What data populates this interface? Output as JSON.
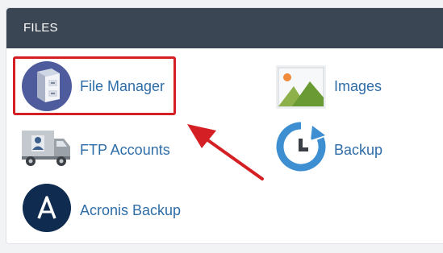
{
  "section": {
    "title": "FILES"
  },
  "items": [
    {
      "label": "File Manager",
      "icon": "file-cabinet-icon"
    },
    {
      "label": "Images",
      "icon": "images-icon"
    },
    {
      "label": "FTP Accounts",
      "icon": "ftp-truck-icon"
    },
    {
      "label": "Backup",
      "icon": "backup-clock-icon"
    },
    {
      "label": "Acronis Backup",
      "icon": "acronis-icon"
    }
  ],
  "colors": {
    "header": "#3b4655",
    "link": "#2f6da8",
    "highlight": "#d42024"
  }
}
